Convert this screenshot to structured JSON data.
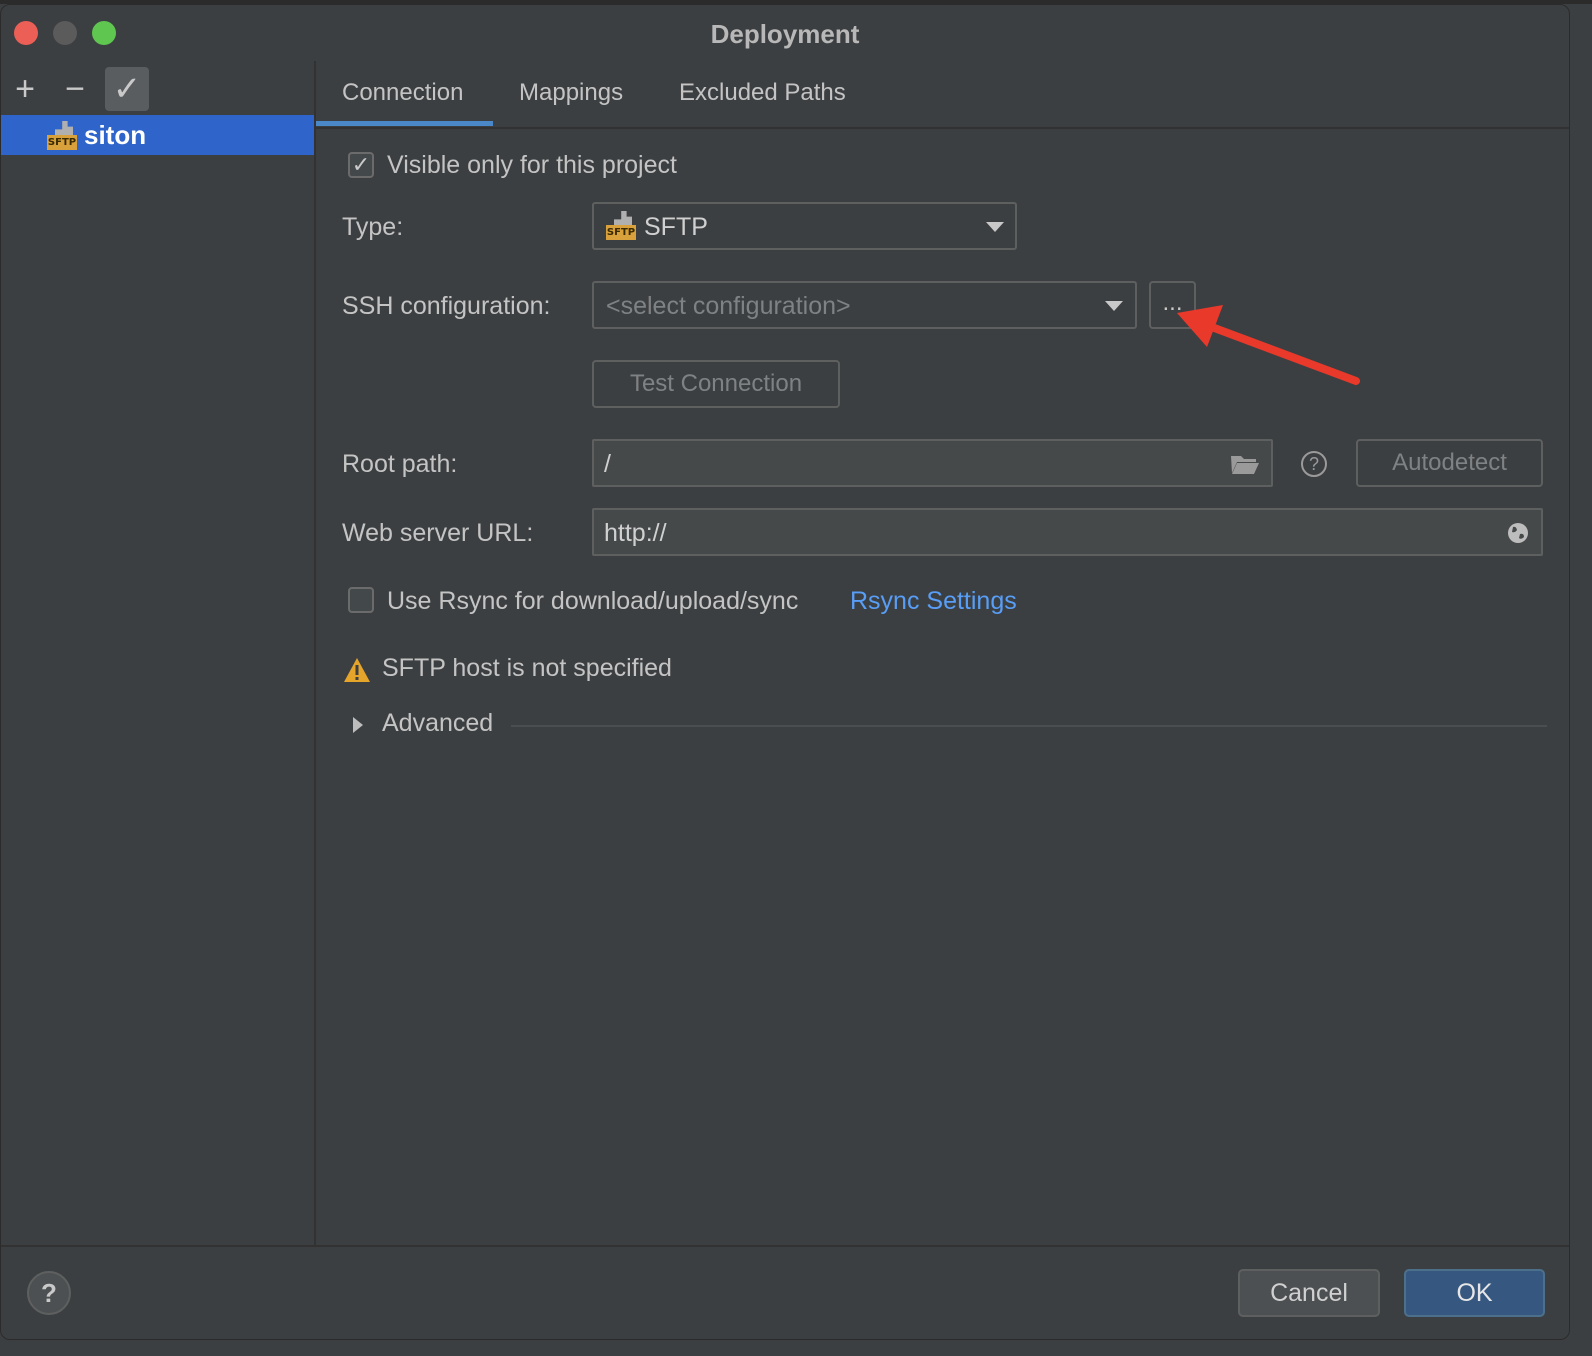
{
  "window": {
    "title": "Deployment"
  },
  "sidebar": {
    "tools": {
      "add": "+",
      "remove": "−",
      "apply": "✓"
    },
    "items": [
      {
        "label": "siton",
        "icon": "sftp-server-icon",
        "icon_text": "SFTP",
        "selected": true
      }
    ]
  },
  "tabs": [
    {
      "label": "Connection",
      "active": true
    },
    {
      "label": "Mappings",
      "active": false
    },
    {
      "label": "Excluded Paths",
      "active": false
    }
  ],
  "form": {
    "visible_only": {
      "label": "Visible only for this project",
      "checked": true
    },
    "type": {
      "label": "Type:",
      "value": "SFTP",
      "icon_text": "SFTP"
    },
    "ssh": {
      "label": "SSH configuration:",
      "placeholder": "<select configuration>",
      "browse_label": "..."
    },
    "test_connection": "Test Connection",
    "root_path": {
      "label": "Root path:",
      "value": "/",
      "autodetect_label": "Autodetect",
      "help": "?"
    },
    "web_server_url": {
      "label": "Web server URL:",
      "value": "http://"
    },
    "rsync": {
      "label": "Use Rsync for download/upload/sync",
      "checked": false,
      "settings_link": "Rsync Settings"
    },
    "warning": "SFTP host is not specified",
    "advanced": "Advanced"
  },
  "footer": {
    "help": "?",
    "cancel": "Cancel",
    "ok": "OK"
  },
  "colors": {
    "accent": "#2f65ca",
    "link": "#589df6",
    "warning": "#e4a52a",
    "ok_button": "#365880",
    "annotation_arrow": "#e8392b"
  }
}
